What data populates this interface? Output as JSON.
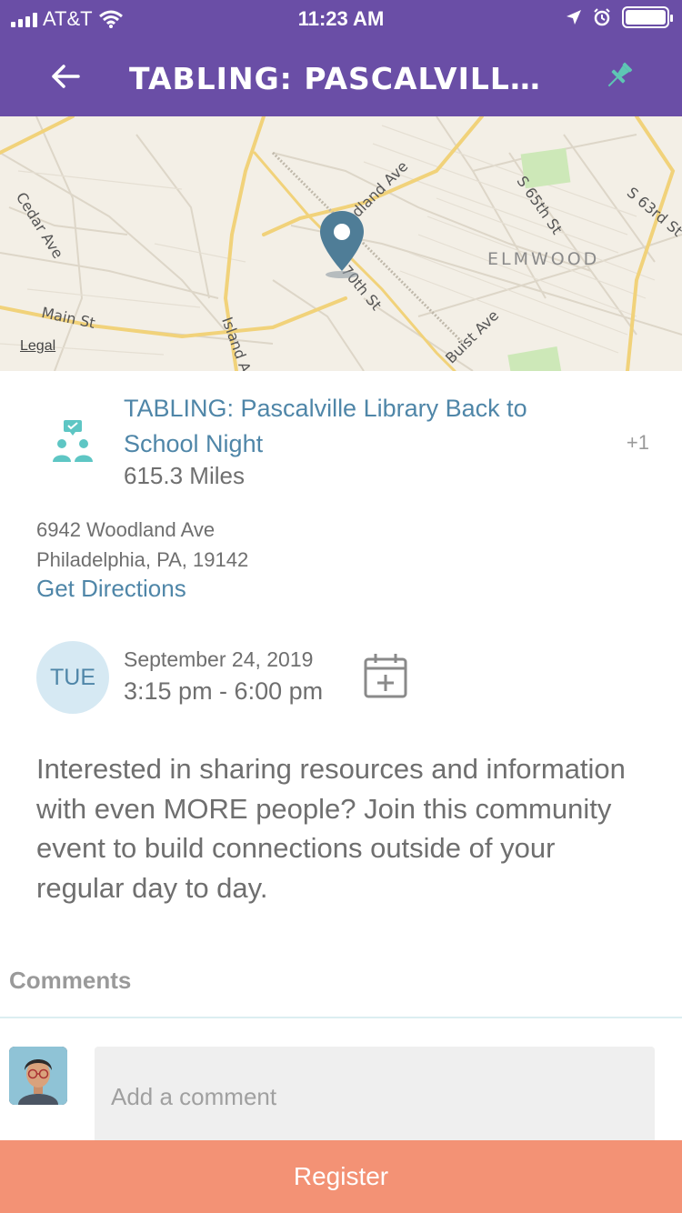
{
  "status_bar": {
    "carrier": "AT&T",
    "time": "11:23 AM"
  },
  "header": {
    "title": "TABLING: PASCALVILLE LIBRARY B...",
    "back_icon": "arrow-left-icon",
    "pin_icon": "pushpin-icon",
    "color": "#6a4ea6",
    "pin_color": "#5ec6b4"
  },
  "map": {
    "streets": [
      "Cedar Ave",
      "Woodland Ave",
      "S 65th St",
      "S 63rd St",
      "ELMWOOD",
      "Main St",
      "70th St",
      "Island A",
      "Buist Ave"
    ],
    "legal": "Legal",
    "marker_icon": "map-pin-icon"
  },
  "event": {
    "icon": "group-event-icon",
    "title": "TABLING: Pascalville Library Back to School Night",
    "attendees_extra": "+1",
    "distance": "615.3 Miles",
    "address_line1": "6942 Woodland Ave",
    "address_line2": "Philadelphia, PA, 19142",
    "directions_label": "Get Directions",
    "day": "TUE",
    "date": "September 24, 2019",
    "time_range": "3:15 pm - 6:00 pm",
    "calendar_icon": "calendar-add-icon",
    "description": "Interested in sharing resources and information with even MORE people? Join this community event to build connections outside of your regular day to day."
  },
  "comments": {
    "label": "Comments",
    "placeholder": "Add a comment"
  },
  "footer": {
    "register_label": "Register",
    "register_color": "#f39275"
  }
}
